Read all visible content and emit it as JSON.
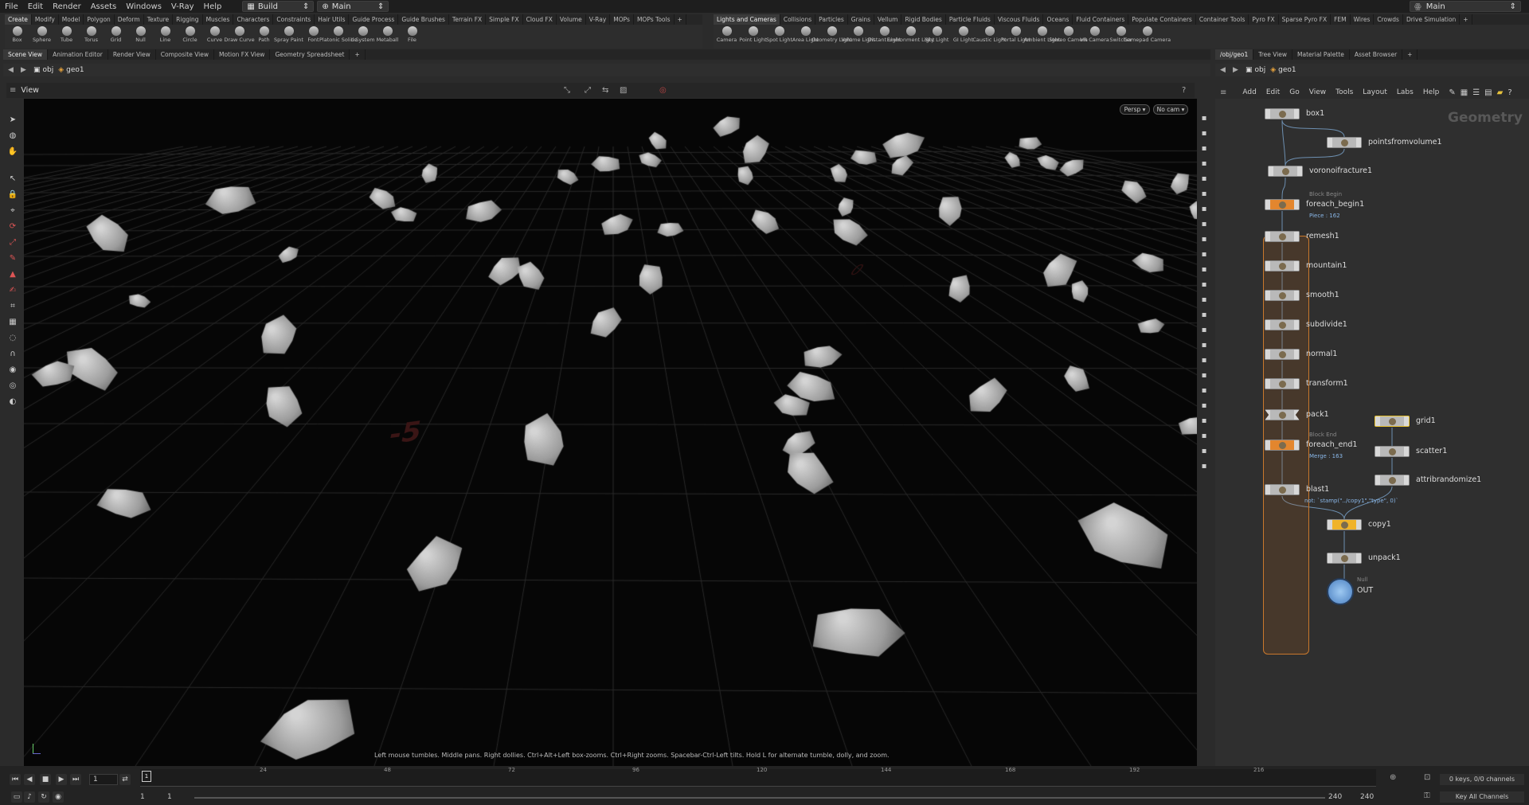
{
  "menubar": {
    "items": [
      "File",
      "Edit",
      "Render",
      "Assets",
      "Windows",
      "V-Ray",
      "Help"
    ],
    "desktop": "Build",
    "context": "Main",
    "right_context": "Main"
  },
  "shelf_left": {
    "tabs": [
      "Create",
      "Modify",
      "Model",
      "Polygon",
      "Deform",
      "Texture",
      "Rigging",
      "Muscles",
      "Characters",
      "Constraints",
      "Hair Utils",
      "Guide Process",
      "Guide Brushes",
      "Terrain FX",
      "Simple FX",
      "Cloud FX",
      "Volume",
      "V-Ray",
      "MOPs",
      "MOPs Tools"
    ],
    "tools": [
      "Box",
      "Sphere",
      "Tube",
      "Torus",
      "Grid",
      "Null",
      "Line",
      "Circle",
      "Curve",
      "Draw Curve",
      "Path",
      "Spray Paint",
      "Font",
      "Platonic Solids",
      "L-System",
      "Metaball",
      "File"
    ]
  },
  "shelf_right": {
    "tabs": [
      "Lights and Cameras",
      "Collisions",
      "Particles",
      "Grains",
      "Vellum",
      "Rigid Bodies",
      "Particle Fluids",
      "Viscous Fluids",
      "Oceans",
      "Fluid Containers",
      "Populate Containers",
      "Container Tools",
      "Pyro FX",
      "Sparse Pyro FX",
      "FEM",
      "Wires",
      "Crowds",
      "Drive Simulation"
    ],
    "tools": [
      "Camera",
      "Point Light",
      "Spot Light",
      "Area Light",
      "Geometry Light",
      "Volume Light",
      "Distant Light",
      "Environment Light",
      "Sky Light",
      "GI Light",
      "Caustic Light",
      "Portal Light",
      "Ambient Light",
      "Stereo Camera",
      "VR Camera",
      "Switcher",
      "Gamepad Camera"
    ]
  },
  "pane_tabs_left": [
    "Scene View",
    "Animation Editor",
    "Render View",
    "Composite View",
    "Motion FX View",
    "Geometry Spreadsheet"
  ],
  "pane_tabs_right": [
    "/obj/geo1",
    "Tree View",
    "Material Palette",
    "Asset Browser"
  ],
  "path_left": {
    "root": "obj",
    "node": "geo1"
  },
  "path_right": {
    "root": "obj",
    "node": "geo1"
  },
  "viewport": {
    "title": "View",
    "persp": "Persp",
    "camera": "No cam",
    "status": "Left mouse tumbles. Middle pans. Right dollies. Ctrl+Alt+Left box-zooms. Ctrl+Right zooms. Spacebar-Ctrl-Left tilts. Hold L for alternate tumble, dolly, and zoom.",
    "grid_labels": [
      "-5",
      "0"
    ]
  },
  "network": {
    "menu": [
      "Add",
      "Edit",
      "Go",
      "View",
      "Tools",
      "Layout",
      "Labs",
      "Help"
    ],
    "context_label": "Geometry",
    "nodes": [
      {
        "name": "box1",
        "sub": "",
        "small": ""
      },
      {
        "name": "pointsfromvolume1",
        "sub": "",
        "small": ""
      },
      {
        "name": "voronoifracture1",
        "sub": "",
        "small": ""
      },
      {
        "name": "foreach_begin1",
        "sub": "Piece : 162",
        "small": "Block Begin"
      },
      {
        "name": "remesh1",
        "sub": "",
        "small": ""
      },
      {
        "name": "mountain1",
        "sub": "",
        "small": ""
      },
      {
        "name": "smooth1",
        "sub": "",
        "small": ""
      },
      {
        "name": "subdivide1",
        "sub": "",
        "small": ""
      },
      {
        "name": "normal1",
        "sub": "",
        "small": ""
      },
      {
        "name": "transform1",
        "sub": "",
        "small": ""
      },
      {
        "name": "pack1",
        "sub": "",
        "small": ""
      },
      {
        "name": "foreach_end1",
        "sub": "Merge : 163",
        "small": "Block End"
      },
      {
        "name": "grid1",
        "sub": "",
        "small": ""
      },
      {
        "name": "scatter1",
        "sub": "",
        "small": ""
      },
      {
        "name": "attribrandomize1",
        "sub": "",
        "small": ""
      },
      {
        "name": "blast1",
        "sub": "not: `stamp(\"../copy1\",\"type\", 0)`",
        "small": ""
      },
      {
        "name": "copy1",
        "sub": "",
        "small": ""
      },
      {
        "name": "unpack1",
        "sub": "",
        "small": ""
      },
      {
        "name": "OUT",
        "sub": "",
        "small": "Null"
      }
    ]
  },
  "timeline": {
    "ticks": [
      "24",
      "48",
      "72",
      "96",
      "120",
      "144",
      "168",
      "192",
      "216"
    ],
    "current_frame": "1",
    "range_start": "1",
    "range_start2": "1",
    "range_end": "240",
    "range_end2": "240",
    "keys_info": "0 keys, 0/0 channels",
    "key_all": "Key All Channels"
  }
}
